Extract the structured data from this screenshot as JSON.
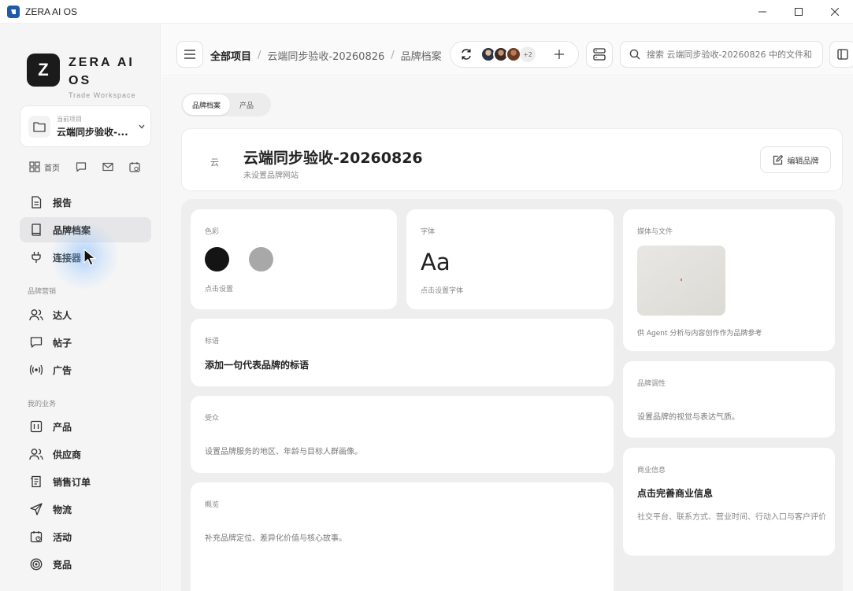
{
  "window": {
    "title": "ZERA AI OS"
  },
  "sidebar": {
    "logo_letter": "Z",
    "brand_name": "ZERA AI OS",
    "brand_sub": "Trade Workspace",
    "project": {
      "label": "当前项目",
      "name": "云端同步验收-..."
    },
    "quick": {
      "home_label": "首页"
    },
    "top_items": [
      {
        "label": "报告",
        "icon": "document-icon"
      },
      {
        "label": "品牌档案",
        "icon": "book-icon",
        "active": true
      },
      {
        "label": "连接器",
        "icon": "plug-icon"
      }
    ],
    "section_marketing": "品牌营销",
    "marketing_items": [
      {
        "label": "达人",
        "icon": "users-icon"
      },
      {
        "label": "帖子",
        "icon": "chat-icon"
      },
      {
        "label": "广告",
        "icon": "broadcast-icon"
      }
    ],
    "section_business": "我的业务",
    "business_items": [
      {
        "label": "产品",
        "icon": "product-icon"
      },
      {
        "label": "供应商",
        "icon": "supplier-icon"
      },
      {
        "label": "销售订单",
        "icon": "order-icon"
      },
      {
        "label": "物流",
        "icon": "send-icon"
      },
      {
        "label": "活动",
        "icon": "calendar-icon"
      },
      {
        "label": "竞品",
        "icon": "target-icon"
      }
    ]
  },
  "topbar": {
    "breadcrumb_root": "全部项目",
    "breadcrumb_project": "云端同步验收-20260826",
    "breadcrumb_current": "品牌档案",
    "collaborators_extra": "+2",
    "search_placeholder": "搜索 云端同步验收-20260826 中的文件和"
  },
  "main": {
    "tabs": [
      {
        "label": "品牌档案",
        "active": true
      },
      {
        "label": "产品",
        "active": false
      }
    ],
    "brand": {
      "initial": "云",
      "title": "云端同步验收-20260826",
      "website": "未设置品牌网站",
      "edit_label": "编辑品牌"
    },
    "colors_card": {
      "label": "色彩",
      "hint": "点击设置",
      "swatches": [
        "#141414",
        "#a8a8a8"
      ]
    },
    "font_card": {
      "label": "字体",
      "sample": "Aa",
      "hint": "点击设置字体"
    },
    "media_card": {
      "label": "媒体与文件",
      "hint": "供 Agent 分析与内容创作作为品牌参考"
    },
    "slogan_card": {
      "label": "标语",
      "value": "添加一句代表品牌的标语"
    },
    "tone_card": {
      "label": "品牌调性",
      "value": "设置品牌的视觉与表达气质。"
    },
    "audience_card": {
      "label": "受众",
      "value": "设置品牌服务的地区、年龄与目标人群画像。"
    },
    "business_card": {
      "label": "商业信息",
      "title": "点击完善商业信息",
      "value": "社交平台、联系方式、营业时间、行动入口与客户评价"
    },
    "overview_card": {
      "label": "概览",
      "value": "补充品牌定位、差异化价值与核心故事。"
    }
  }
}
